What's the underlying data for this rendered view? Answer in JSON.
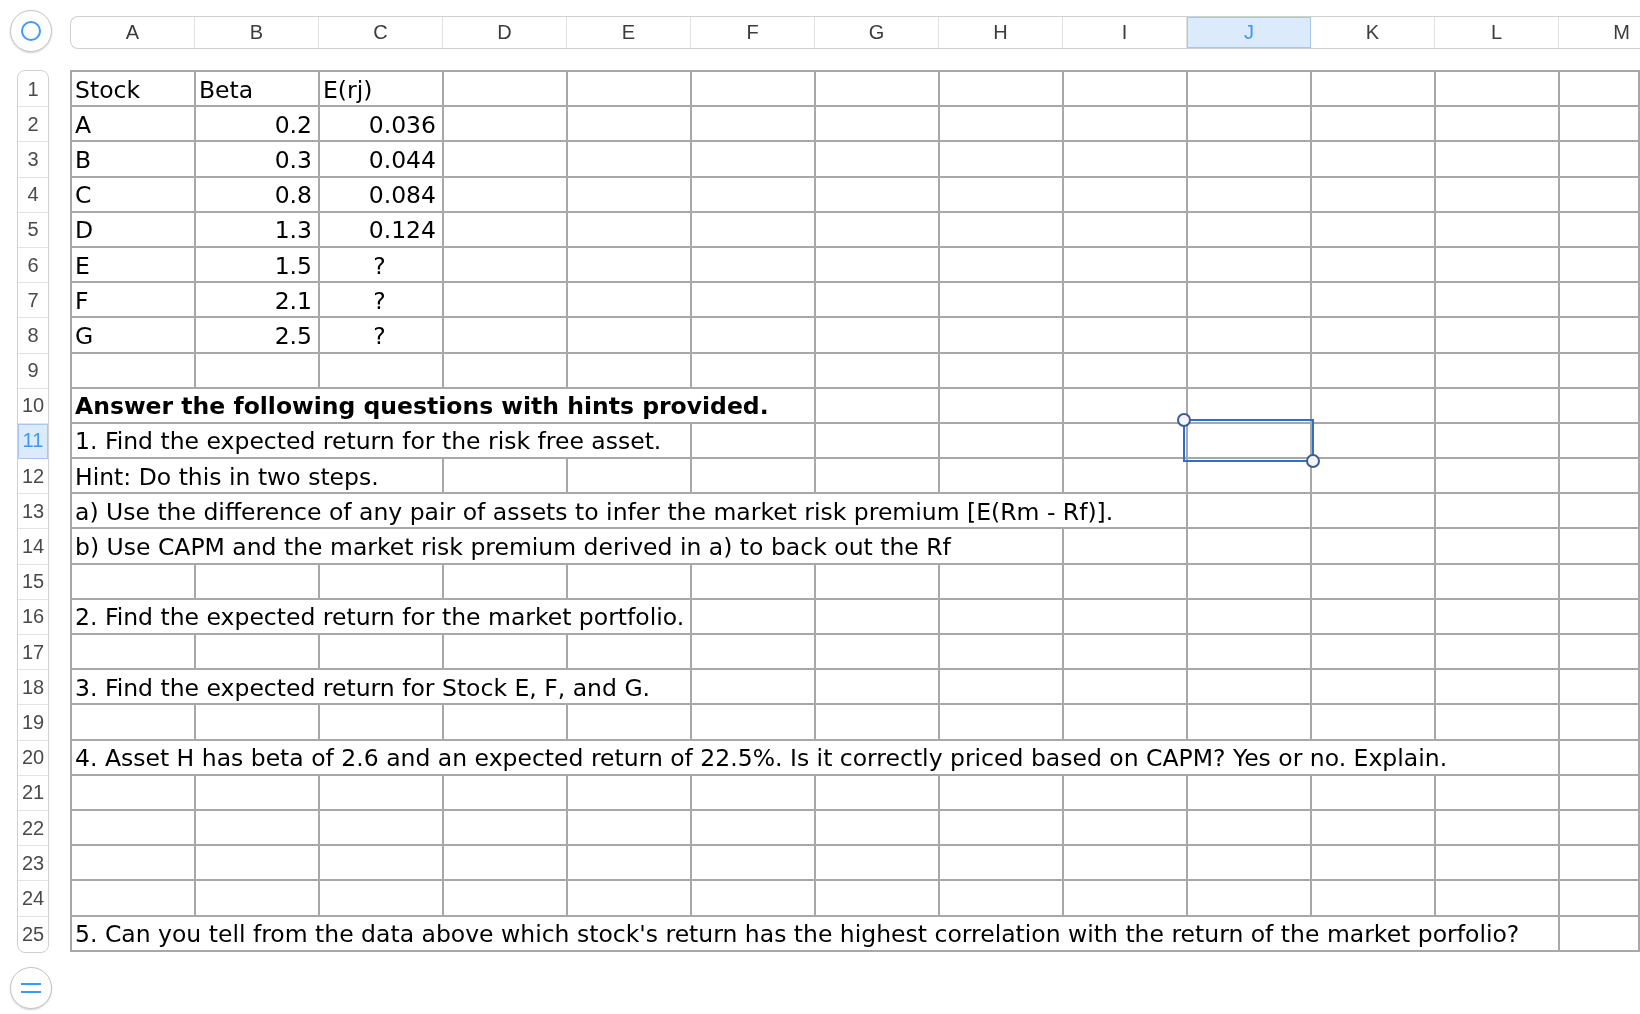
{
  "sheet": {
    "columns": [
      {
        "label": "A",
        "selected": false
      },
      {
        "label": "B",
        "selected": false
      },
      {
        "label": "C",
        "selected": false
      },
      {
        "label": "D",
        "selected": false
      },
      {
        "label": "E",
        "selected": false
      },
      {
        "label": "F",
        "selected": false
      },
      {
        "label": "G",
        "selected": false
      },
      {
        "label": "H",
        "selected": false
      },
      {
        "label": "I",
        "selected": false
      },
      {
        "label": "J",
        "selected": true
      },
      {
        "label": "K",
        "selected": false
      },
      {
        "label": "L",
        "selected": false
      },
      {
        "label": "M",
        "selected": false
      }
    ],
    "rows": [
      {
        "label": "1",
        "selected": false,
        "kind": "cells",
        "cells": [
          {
            "kind": "label",
            "text": "Stock"
          },
          {
            "kind": "label",
            "text": "Beta"
          },
          {
            "kind": "label",
            "text": "E(rj)"
          }
        ]
      },
      {
        "label": "2",
        "selected": false,
        "kind": "cells",
        "cells": [
          {
            "kind": "label",
            "text": "A"
          },
          {
            "kind": "number",
            "text": "0.2"
          },
          {
            "kind": "number",
            "text": "0.036"
          }
        ]
      },
      {
        "label": "3",
        "selected": false,
        "kind": "cells",
        "cells": [
          {
            "kind": "label",
            "text": "B"
          },
          {
            "kind": "number",
            "text": "0.3"
          },
          {
            "kind": "number",
            "text": "0.044"
          }
        ]
      },
      {
        "label": "4",
        "selected": false,
        "kind": "cells",
        "cells": [
          {
            "kind": "label",
            "text": "C"
          },
          {
            "kind": "number",
            "text": "0.8"
          },
          {
            "kind": "number",
            "text": "0.084"
          }
        ]
      },
      {
        "label": "5",
        "selected": false,
        "kind": "cells",
        "cells": [
          {
            "kind": "label",
            "text": "D"
          },
          {
            "kind": "number",
            "text": "1.3"
          },
          {
            "kind": "number",
            "text": "0.124"
          }
        ]
      },
      {
        "label": "6",
        "selected": false,
        "kind": "cells",
        "cells": [
          {
            "kind": "label",
            "text": "E"
          },
          {
            "kind": "number",
            "text": "1.5"
          },
          {
            "kind": "unknown",
            "text": "?"
          }
        ]
      },
      {
        "label": "7",
        "selected": false,
        "kind": "cells",
        "cells": [
          {
            "kind": "label",
            "text": "F"
          },
          {
            "kind": "number",
            "text": "2.1"
          },
          {
            "kind": "unknown",
            "text": "?"
          }
        ]
      },
      {
        "label": "8",
        "selected": false,
        "kind": "cells",
        "cells": [
          {
            "kind": "label",
            "text": "G"
          },
          {
            "kind": "number",
            "text": "2.5"
          },
          {
            "kind": "unknown",
            "text": "?"
          }
        ]
      },
      {
        "label": "9",
        "selected": false,
        "kind": "empty"
      },
      {
        "label": "10",
        "selected": false,
        "kind": "heading",
        "text": "Answer the following questions with hints provided."
      },
      {
        "label": "11",
        "selected": true,
        "kind": "note",
        "text": "1. Find the expected return for the risk free asset."
      },
      {
        "label": "12",
        "selected": false,
        "kind": "note",
        "text": "Hint: Do this in two steps."
      },
      {
        "label": "13",
        "selected": false,
        "kind": "note",
        "text": "a) Use the difference of any pair of assets to infer the market risk premium [E(Rm - Rf)]."
      },
      {
        "label": "14",
        "selected": false,
        "kind": "note",
        "text": "b) Use CAPM and the market risk premium derived in a) to back out the Rf"
      },
      {
        "label": "15",
        "selected": false,
        "kind": "empty"
      },
      {
        "label": "16",
        "selected": false,
        "kind": "note",
        "text": "2. Find the expected return for the market portfolio."
      },
      {
        "label": "17",
        "selected": false,
        "kind": "empty"
      },
      {
        "label": "18",
        "selected": false,
        "kind": "note",
        "text": "3. Find the expected return for Stock E, F, and G."
      },
      {
        "label": "19",
        "selected": false,
        "kind": "empty"
      },
      {
        "label": "20",
        "selected": false,
        "kind": "note",
        "text": "4. Asset H has beta of 2.6 and an expected return of 22.5%. Is it correctly priced based on CAPM? Yes or no. Explain."
      },
      {
        "label": "21",
        "selected": false,
        "kind": "empty"
      },
      {
        "label": "22",
        "selected": false,
        "kind": "empty"
      },
      {
        "label": "23",
        "selected": false,
        "kind": "empty"
      },
      {
        "label": "24",
        "selected": false,
        "kind": "empty"
      },
      {
        "label": "25",
        "selected": false,
        "kind": "note",
        "text": "5. Can you tell from the data above which stock's return has the highest correlation with the return of the market porfolio?"
      }
    ]
  }
}
